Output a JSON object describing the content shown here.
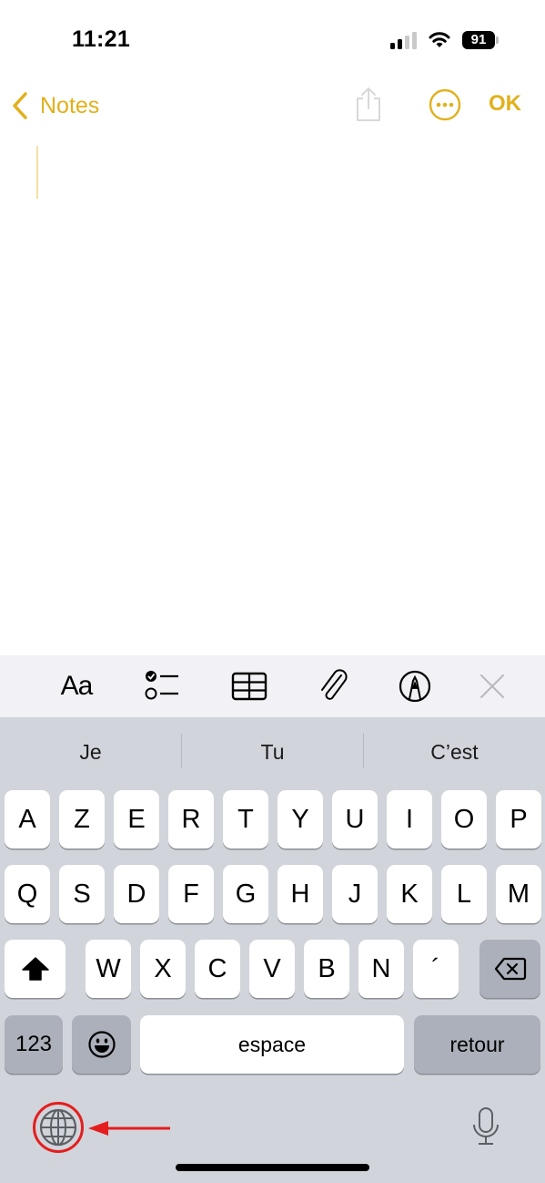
{
  "status_bar": {
    "time": "11:21",
    "battery_level": "91",
    "signal_bars_active": 2,
    "signal_bars_total": 4,
    "icons": [
      "cellular-signal-icon",
      "wifi-icon",
      "battery-icon"
    ]
  },
  "nav": {
    "back_label": "Notes",
    "ok_label": "OK",
    "accent_color": "#E2B01B",
    "icons": [
      "chevron-left-icon",
      "share-icon",
      "more-ellipsis-icon"
    ]
  },
  "note": {
    "content": ""
  },
  "format_toolbar": {
    "text_style_label": "Aa",
    "items": [
      "text-style",
      "checklist",
      "table",
      "attachment",
      "markup",
      "close"
    ]
  },
  "keyboard": {
    "suggestions": [
      "Je",
      "Tu",
      "C’est"
    ],
    "row1": [
      "A",
      "Z",
      "E",
      "R",
      "T",
      "Y",
      "U",
      "I",
      "O",
      "P"
    ],
    "row2": [
      "Q",
      "S",
      "D",
      "F",
      "G",
      "H",
      "J",
      "K",
      "L",
      "M"
    ],
    "row3": [
      "W",
      "X",
      "C",
      "V",
      "B",
      "N",
      "´"
    ],
    "numbers_label": "123",
    "space_label": "espace",
    "return_label": "retour",
    "key_color": "#FFFFFF",
    "special_key_color": "#ABB0BA",
    "background_color": "#D1D4DA"
  },
  "annotation": {
    "highlight_target": "globe-button",
    "color": "#E41E1E"
  }
}
